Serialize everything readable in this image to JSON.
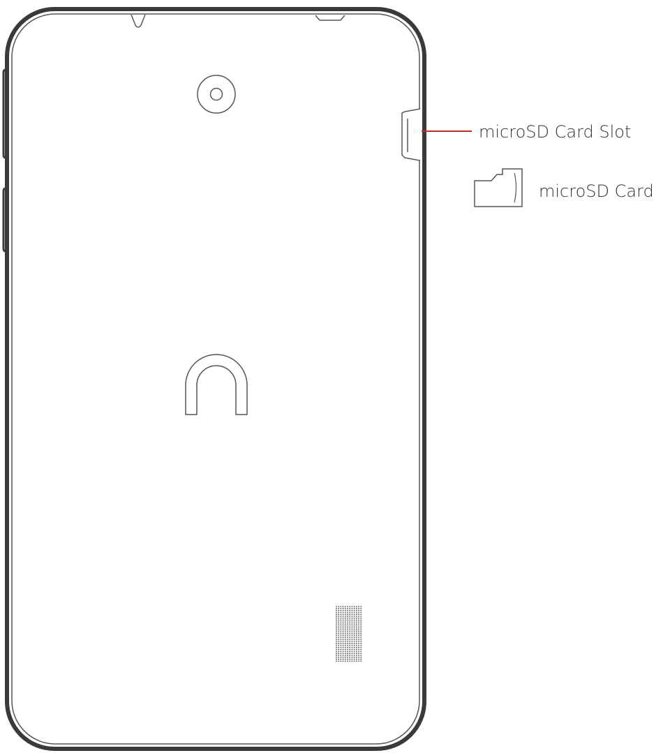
{
  "labels": {
    "slot_label": "microSD Card Slot",
    "card_label": "microSD Card"
  },
  "colors": {
    "outline": "#3a3a3a",
    "line": "#555555",
    "callout": "#e31b23",
    "text": "#333333",
    "background": "#ffffff"
  },
  "icons": {
    "camera": "camera-lens-icon",
    "logo": "nook-logo-icon",
    "speaker": "speaker-grille-icon",
    "card": "microsd-card-icon"
  }
}
